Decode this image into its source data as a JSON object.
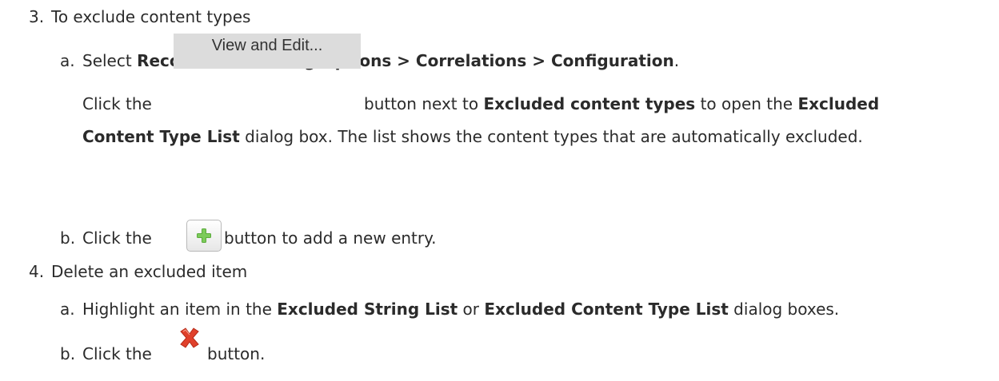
{
  "steps": [
    {
      "number": "3.",
      "title": "To exclude content types",
      "substeps": [
        {
          "letter": "a.",
          "line1": {
            "t1": "Select ",
            "b1": "Record > Recording Options > Correlations > Configuration",
            "t2": "."
          },
          "line2": {
            "t1": "Click the ",
            "button_label": "View and Edit...",
            "t2": " button next to ",
            "b1": "Excluded content types",
            "t3": " to open the ",
            "b2": "Excluded"
          },
          "line3": {
            "b1": "Content Type List",
            "t1": " dialog box. The list shows the content types that are automatically excluded."
          }
        },
        {
          "letter": "b.",
          "t1": "Click the ",
          "icon": "plus-icon",
          "t2": " button to add a new entry."
        }
      ]
    },
    {
      "number": "4.",
      "title": "Delete an excluded item",
      "substeps": [
        {
          "letter": "a.",
          "t1": "Highlight an item in the ",
          "b1": "Excluded String List",
          "t2": " or ",
          "b2": "Excluded Content Type List",
          "t3": " dialog boxes."
        },
        {
          "letter": "b.",
          "t1": "Click the ",
          "icon": "delete-x-icon",
          "t2": " button."
        }
      ]
    }
  ],
  "colors": {
    "text": "#2b2b2b",
    "plus_green": "#5bab3c",
    "x_red": "#e0412b",
    "button_gray": "#dcdcdc"
  }
}
